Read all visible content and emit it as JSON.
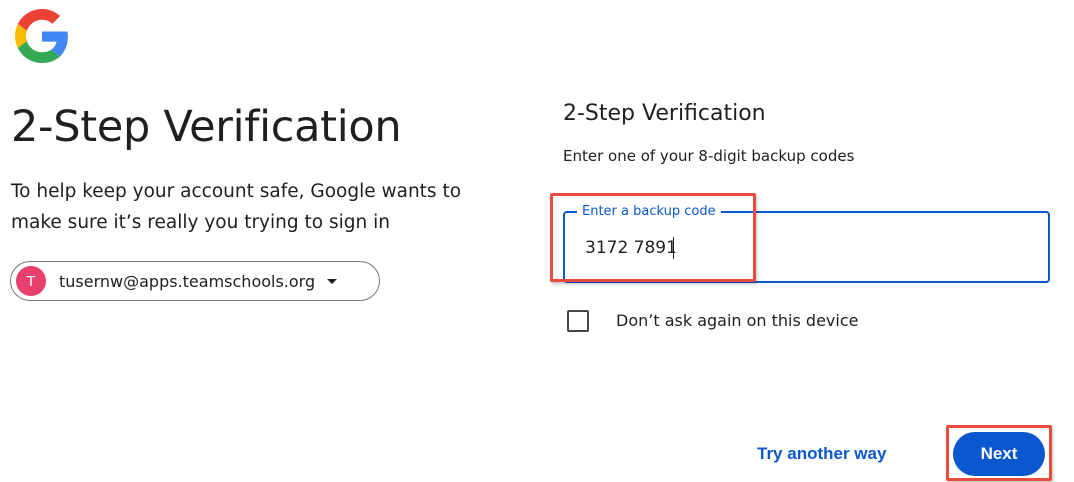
{
  "logo": {
    "name": "google-logo-icon",
    "colors": {
      "blue": "#4285F4",
      "red": "#EA4335",
      "yellow": "#FBBC05",
      "green": "#34A853"
    }
  },
  "left": {
    "title": "2-Step Verification",
    "subtitle": "To help keep your account safe, Google wants to make sure it’s really you trying to sign in",
    "account": {
      "avatar_letter": "T",
      "email": "tusernw@apps.teamschools.org",
      "avatar_color": "#E8406D"
    }
  },
  "right": {
    "title": "2-Step Verification",
    "subtitle": "Enter one of your 8-digit backup codes",
    "field": {
      "label": "Enter a backup code",
      "value": "3172 7891"
    },
    "checkbox": {
      "label": "Don’t ask again on this device",
      "checked": false
    }
  },
  "actions": {
    "try_another": "Try another way",
    "next": "Next"
  },
  "colors": {
    "accent": "#0B57D0",
    "annotation": "#E84C3D"
  }
}
